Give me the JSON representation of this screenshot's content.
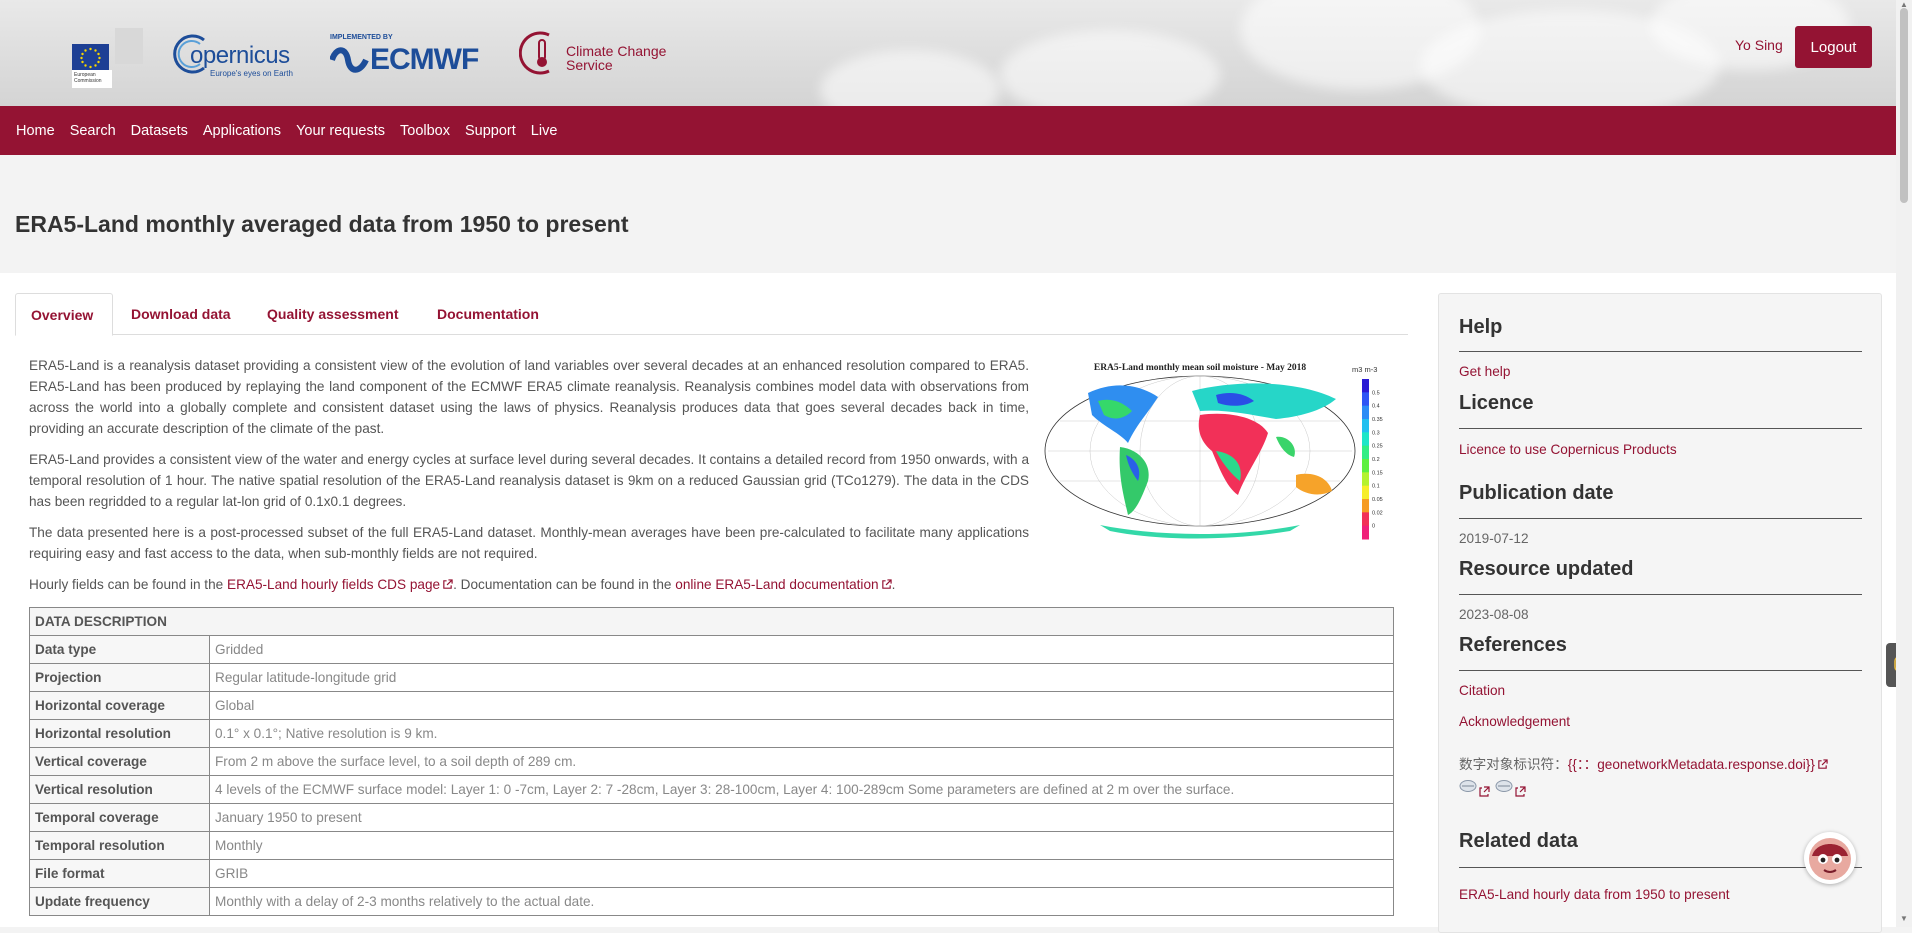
{
  "header": {
    "logos": {
      "eu_line1": "European",
      "eu_line2": "Commission",
      "copernicus_name": "opernicus",
      "copernicus_tagline": "Europe's eyes on Earth",
      "ecmwf_implemented": "IMPLEMENTED BY",
      "ecmwf_name": "ECMWF",
      "c3s_line1": "Climate Change",
      "c3s_line2": "Service"
    },
    "user_name": "Yo Sing",
    "logout_label": "Logout"
  },
  "nav": {
    "items": [
      "Home",
      "Search",
      "Datasets",
      "Applications",
      "Your requests",
      "Toolbox",
      "Support",
      "Live"
    ]
  },
  "page": {
    "title": "ERA5-Land monthly averaged data from 1950 to present"
  },
  "tabs": [
    "Overview",
    "Download data",
    "Quality assessment",
    "Documentation"
  ],
  "overview": {
    "p1": "ERA5-Land is a reanalysis dataset providing a consistent view of the evolution of land variables over several decades at an enhanced resolution compared to ERA5. ERA5-Land has been produced by replaying the land component of the ECMWF ERA5 climate reanalysis. Reanalysis combines model data with observations from across the world into a globally complete and consistent dataset using the laws of physics. Reanalysis produces data that goes several decades back in time, providing an accurate description of the climate of the past.",
    "p2": "ERA5-Land provides a consistent view of the water and energy cycles at surface level during several decades. It contains a detailed record from 1950 onwards, with a temporal resolution of 1 hour. The native spatial resolution of the ERA5-Land reanalysis dataset is 9km on a reduced Gaussian grid (TCo1279). The data in the CDS has been regridded to a regular lat-lon grid of 0.1x0.1 degrees.",
    "p3": "The data presented here is a post-processed subset of the full ERA5-Land dataset. Monthly-mean averages have been pre-calculated to facilitate many applications requiring easy and fast access to the data, when sub-monthly fields are not required.",
    "p4_pre": "Hourly fields can be found in the ",
    "p4_link1": "ERA5-Land hourly fields CDS page",
    "p4_mid": ". Documentation can be found in the ",
    "p4_link2": "online ERA5-Land documentation",
    "p4_end": "."
  },
  "map_figure": {
    "title": "ERA5-Land monthly mean soil moisture - May 2018",
    "unit": "m3 m-3",
    "scale_labels": [
      "0.5",
      "0.4",
      "0.35",
      "0.3",
      "0.25",
      "0.2",
      "0.15",
      "0.1",
      "0.05",
      "0.02",
      "0"
    ],
    "scale_colors": [
      "#2b1bd4",
      "#2f56f5",
      "#2d8df6",
      "#22c0f0",
      "#1ee6c8",
      "#31ee84",
      "#5ef040",
      "#b4f230",
      "#f6ee2c",
      "#f69c24",
      "#f23058",
      "#f0207a"
    ]
  },
  "data_description": {
    "heading": "DATA DESCRIPTION",
    "rows": [
      {
        "key": "Data type",
        "value": "Gridded"
      },
      {
        "key": "Projection",
        "value": "Regular latitude-longitude grid"
      },
      {
        "key": "Horizontal coverage",
        "value": "Global"
      },
      {
        "key": "Horizontal resolution",
        "value": "0.1° x 0.1°; Native resolution is 9 km."
      },
      {
        "key": "Vertical coverage",
        "value": "From 2 m above the surface level, to a soil depth of 289 cm."
      },
      {
        "key": "Vertical resolution",
        "value": "4 levels of the ECMWF surface model: Layer 1: 0 -7cm, Layer 2: 7 -28cm, Layer 3: 28-100cm, Layer 4: 100-289cm Some parameters are defined at 2 m over the surface."
      },
      {
        "key": "Temporal coverage",
        "value": "January 1950 to present"
      },
      {
        "key": "Temporal resolution",
        "value": "Monthly"
      },
      {
        "key": "File format",
        "value": "GRIB"
      },
      {
        "key": "Update frequency",
        "value": "Monthly with a delay of 2-3 months relatively to the actual date."
      }
    ]
  },
  "sidebar": {
    "help": {
      "heading": "Help",
      "link": "Get help"
    },
    "licence": {
      "heading": "Licence",
      "link": "Licence to use Copernicus Products"
    },
    "publication": {
      "heading": "Publication date",
      "value": "2019-07-12"
    },
    "updated": {
      "heading": "Resource updated",
      "value": "2023-08-08"
    },
    "references": {
      "heading": "References",
      "citation": "Citation",
      "acknowledgement": "Acknowledgement",
      "doi_label": "数字对象标识符：",
      "doi_value": "{{：：geonetworkMetadata.response.doi}}"
    },
    "related": {
      "heading": "Related data",
      "link": "ERA5-Land hourly data from 1950 to present"
    }
  }
}
